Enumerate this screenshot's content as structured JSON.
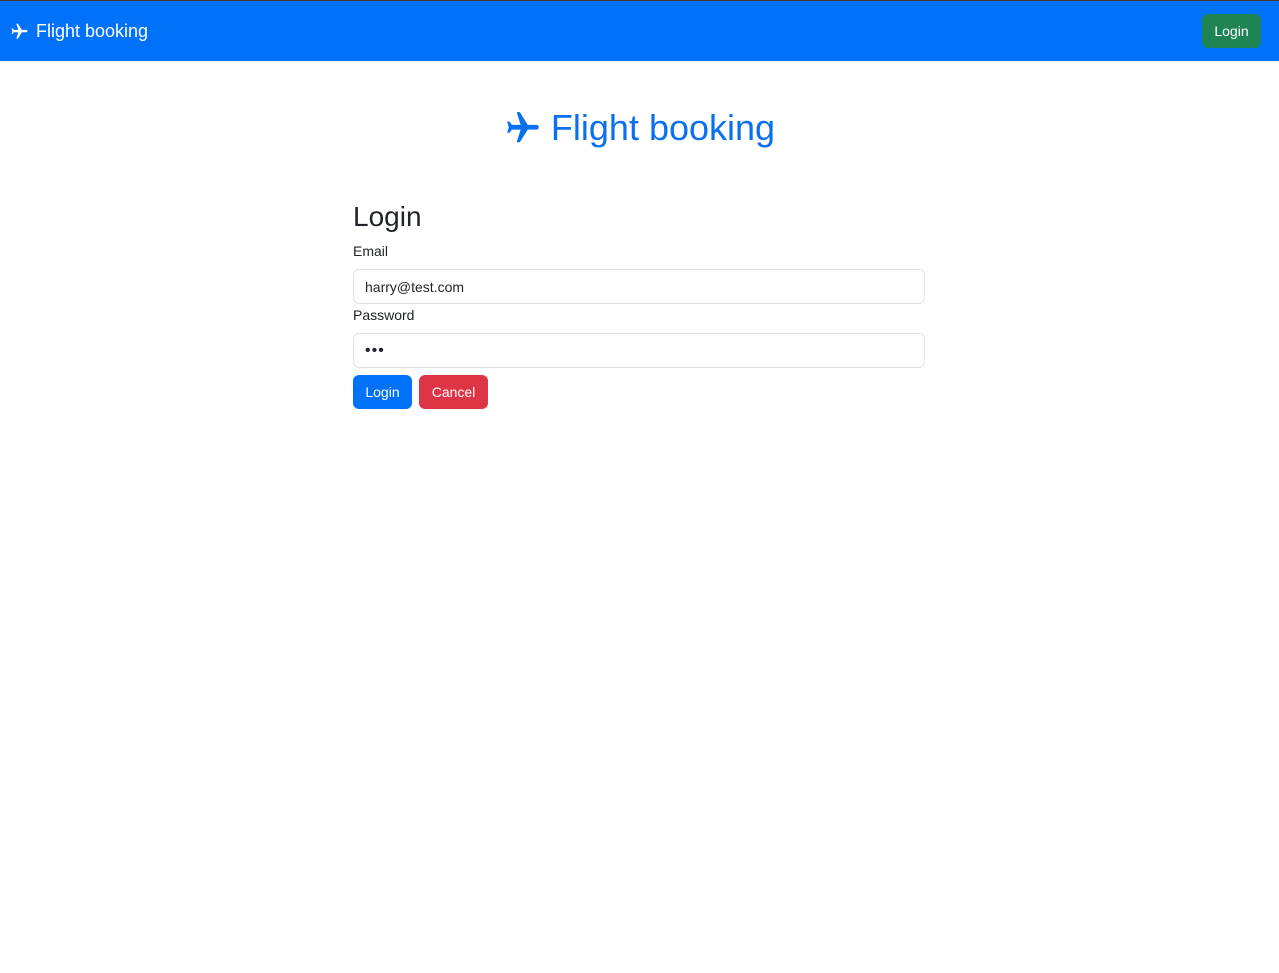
{
  "navbar": {
    "brand_icon": "airplane-icon",
    "brand_label": "Flight booking",
    "login_label": "Login",
    "bg_color": "#0071f9",
    "login_color": "#1f8454"
  },
  "hero": {
    "icon": "airplane-icon",
    "title": "Flight booking",
    "color": "#0b70f0"
  },
  "login_form": {
    "heading": "Login",
    "email_label": "Email",
    "email_value": "harry@test.com",
    "password_label": "Password",
    "password_value": "•••",
    "submit_label": "Login",
    "cancel_label": "Cancel",
    "submit_color": "#0071f9",
    "cancel_color": "#dc3545"
  }
}
